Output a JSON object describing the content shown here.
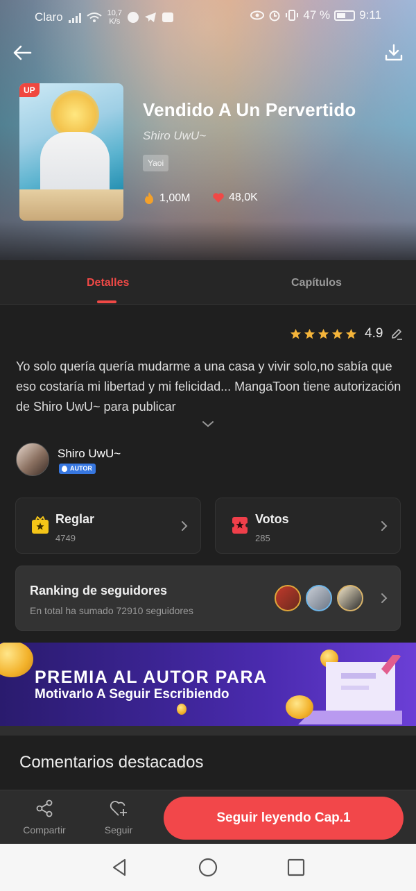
{
  "status_bar": {
    "carrier": "Claro",
    "net_speed_value": "10,7",
    "net_speed_unit": "K/s",
    "battery": "47 %",
    "time": "9:11"
  },
  "book": {
    "up_badge": "UP",
    "title": "Vendido A Un Pervertido",
    "author": "Shiro UwU~",
    "genre": "Yaoi",
    "views": "1,00M",
    "likes": "48,0K"
  },
  "tabs": [
    {
      "label": "Detalles",
      "active": true
    },
    {
      "label": "Capítulos",
      "active": false
    }
  ],
  "rating": {
    "value": "4.9",
    "stars": 5
  },
  "description": "Yo solo quería quería mudarme a una casa y vivir solo,no sabía que eso costaría mi libertad y mi felicidad... MangaToon tiene autorización de Shiro UwU~ para publicar",
  "author_info": {
    "name": "Shiro UwU~",
    "badge": "AUTOR"
  },
  "gift_card": {
    "title": "Reglar",
    "count": "4749"
  },
  "votes_card": {
    "title": "Votos",
    "count": "285"
  },
  "followers_card": {
    "title": "Ranking de seguidores",
    "subtitle": "En total ha sumado 72910 seguidores"
  },
  "banner": {
    "line1": "PREMIA AL AUTOR PARA",
    "line2": "Motivarlo A Seguir Escribiendo"
  },
  "comments": {
    "title": "Comentarios destacados"
  },
  "action_bar": {
    "share_label": "Compartir",
    "follow_label": "Seguir",
    "read_label": "Seguir leyendo Cap.1"
  },
  "colors": {
    "accent": "#f04946",
    "gold": "#f4b43a",
    "background": "#1f1f1f"
  }
}
